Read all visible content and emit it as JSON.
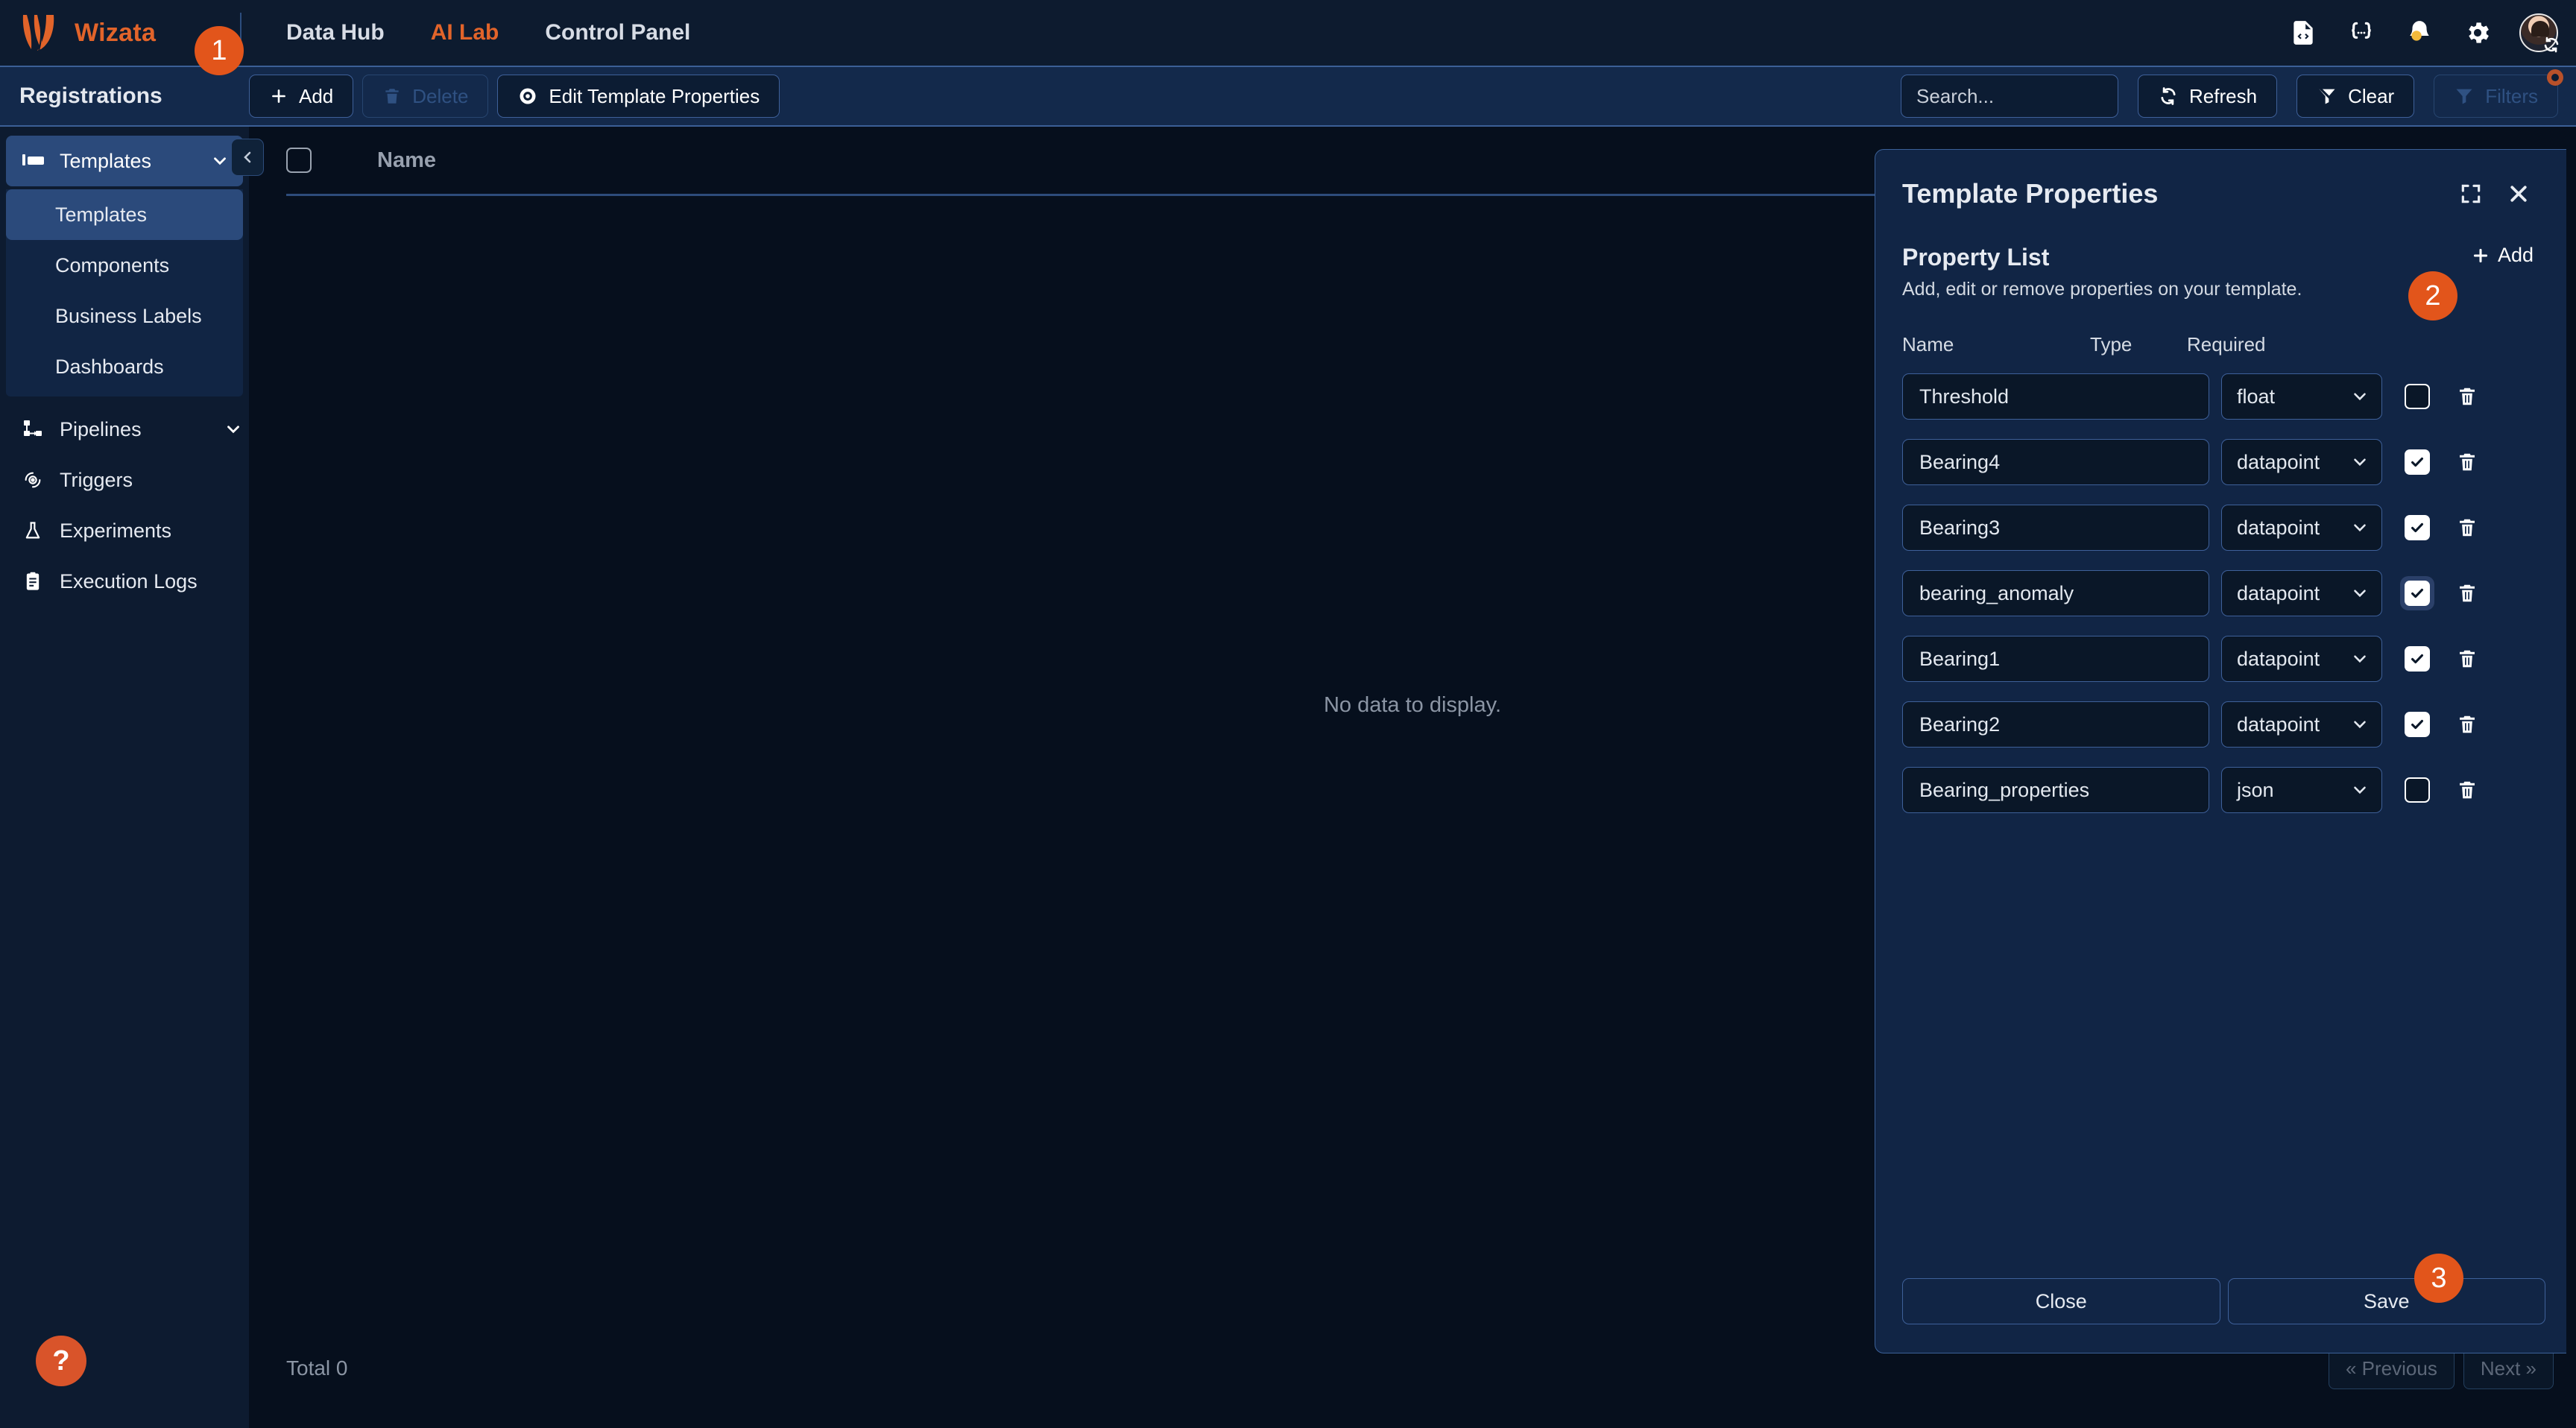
{
  "topnav": {
    "brand": "Wizata",
    "logo_icon": "wizata-flame-logo",
    "links": [
      {
        "label": "Data Hub",
        "active": false
      },
      {
        "label": "AI Lab",
        "active": true
      },
      {
        "label": "Control Panel",
        "active": false
      }
    ],
    "icons": [
      {
        "name": "file-code-icon"
      },
      {
        "name": "json-braces-icon"
      },
      {
        "name": "notification-bell-icon"
      },
      {
        "name": "gear-icon"
      }
    ],
    "avatar_name": "user-avatar",
    "avatar_sync_icon": "sync-icon"
  },
  "toolbar": {
    "page_title": "Registrations",
    "add_label": "Add",
    "add_icon": "plus-icon",
    "delete_label": "Delete",
    "delete_icon": "trash-icon",
    "edit_template_label": "Edit Template Properties",
    "edit_template_icon": "eye-icon",
    "search_placeholder": "Search...",
    "search_value": "",
    "refresh_label": "Refresh",
    "refresh_icon": "refresh-icon",
    "clear_label": "Clear",
    "clear_icon": "funnel-clear-icon",
    "filters_label": "Filters",
    "filters_icon": "funnel-icon"
  },
  "sidebar": {
    "group_label": "Templates",
    "group_icon": "template-icon",
    "chevron_icon": "chevron-down-icon",
    "collapse_icon": "chevron-left-icon",
    "sub_items": [
      {
        "label": "Templates",
        "active": true
      },
      {
        "label": "Components",
        "active": false
      },
      {
        "label": "Business Labels",
        "active": false
      },
      {
        "label": "Dashboards",
        "active": false
      }
    ],
    "items": [
      {
        "label": "Pipelines",
        "icon": "pipeline-icon",
        "chevron": true
      },
      {
        "label": "Triggers",
        "icon": "trigger-gear-icon",
        "chevron": false
      },
      {
        "label": "Experiments",
        "icon": "flask-icon",
        "chevron": false
      },
      {
        "label": "Execution Logs",
        "icon": "clipboard-logs-icon",
        "chevron": false
      }
    ],
    "help_label": "?"
  },
  "table": {
    "select_all_name": "select-all-checkbox",
    "column_name": "Name",
    "empty_message": "No data to display.",
    "total_label": "Total 0",
    "prev_label": "« Previous",
    "next_label": "Next »"
  },
  "panel": {
    "title": "Template Properties",
    "expand_icon": "expand-fullscreen-icon",
    "close_icon": "close-icon",
    "section_title": "Property List",
    "add_label": "Add",
    "add_icon": "plus-icon",
    "section_subtitle": "Add, edit or remove properties on your template.",
    "columns": {
      "name": "Name",
      "type": "Type",
      "required": "Required"
    },
    "rows": [
      {
        "name": "Threshold",
        "type": "float",
        "required": false,
        "focused": false
      },
      {
        "name": "Bearing4",
        "type": "datapoint",
        "required": true,
        "focused": false
      },
      {
        "name": "Bearing3",
        "type": "datapoint",
        "required": true,
        "focused": false
      },
      {
        "name": "bearing_anomaly",
        "type": "datapoint",
        "required": true,
        "focused": true
      },
      {
        "name": "Bearing1",
        "type": "datapoint",
        "required": true,
        "focused": false
      },
      {
        "name": "Bearing2",
        "type": "datapoint",
        "required": true,
        "focused": false
      },
      {
        "name": "Bearing_properties",
        "type": "json",
        "required": false,
        "focused": false
      }
    ],
    "close_label": "Close",
    "save_label": "Save",
    "delete_row_icon": "trash-icon",
    "type_chevron_icon": "chevron-down-icon"
  },
  "steps": [
    {
      "label": "1"
    },
    {
      "label": "2"
    },
    {
      "label": "3"
    }
  ],
  "colors": {
    "accent": "#e2642a",
    "step_badge": "#e2551b",
    "nav_bg": "#0d1b2f",
    "toolbar_bg": "#13294b",
    "panel_bg": "#112545",
    "border_blue": "#3e6099"
  }
}
